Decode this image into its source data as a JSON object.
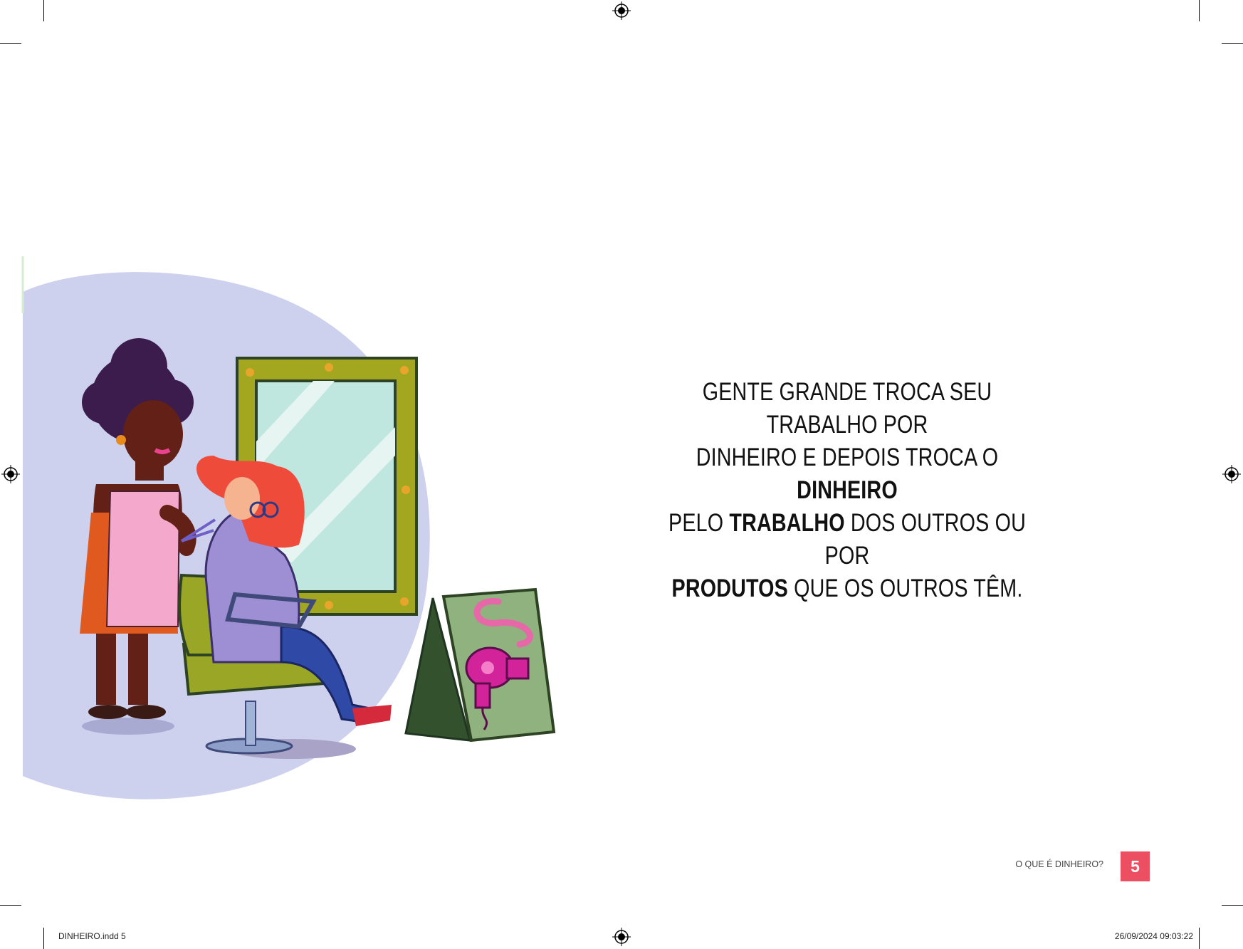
{
  "text": {
    "line1": "GENTE GRANDE TROCA SEU TRABALHO POR",
    "line2_a": "DINHEIRO E DEPOIS TROCA O ",
    "line2_b": "DINHEIRO",
    "line3_a": "PELO ",
    "line3_b": "TRABALHO",
    "line3_c": " DOS OUTROS OU POR",
    "line4_a": "PRODUTOS",
    "line4_b": " QUE OS OUTROS TÊM."
  },
  "footer": {
    "section_title": "O QUE É DINHEIRO?",
    "page_number": "5",
    "badge_color": "#ec4f61"
  },
  "slug": {
    "file": "DINHEIRO.indd   5",
    "datetime": "26/09/2024   09:03:22"
  }
}
